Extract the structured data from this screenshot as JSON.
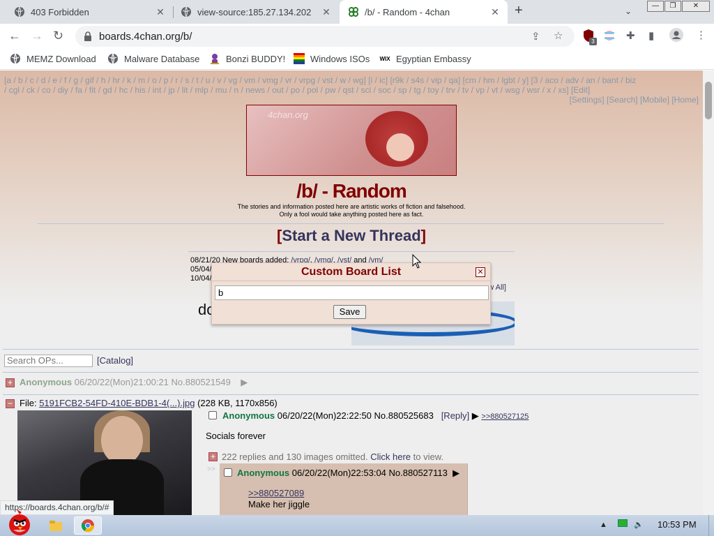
{
  "browser": {
    "tabs": [
      {
        "title": "403 Forbidden",
        "icon": "globe-icon"
      },
      {
        "title": "view-source:185.27.134.202",
        "icon": "globe-icon"
      },
      {
        "title": "/b/ - Random - 4chan",
        "icon": "clover-icon"
      }
    ],
    "url": "boards.4chan.org/b/",
    "extension_badge": "3",
    "bookmarks": [
      {
        "label": "MEMZ Download",
        "icon": "globe-icon"
      },
      {
        "label": "Malware Database",
        "icon": "globe-icon"
      },
      {
        "label": "Bonzi BUDDY!",
        "icon": "bonzi-icon"
      },
      {
        "label": "Windows ISOs",
        "icon": "windows-flag-icon"
      },
      {
        "label": "Egyptian Embassy",
        "icon": "wix-icon"
      }
    ],
    "wix_label": "WIX",
    "status_url": "https://boards.4chan.org/b/#"
  },
  "page": {
    "board_nav_line1": "[a / b / c / d / e / f / g / gif / h / hr / k / m / o / p / r / s / t / u / v / vg / vm / vmg / vr / vrpg / vst / w / wg] [i / ic] [r9k / s4s / vip / qa] [cm / hm / lgbt / y] [3 / aco / adv / an / bant / biz",
    "board_nav_line2": "/ cgl / ck / co / diy / fa / fit / gd / hc / his / int / jp / lit / mlp / mu / n / news / out / po / pol / pw / qst / sci / soc / sp / tg / toy / trv / tv / vp / vt / wsg / wsr / x / xs] [Edit]",
    "top_links": "[Settings] [Search] [Mobile] [Home]",
    "banner_logo": "4chan.org",
    "board_title": "/b/ - Random",
    "subtitle_line1": "The stories and information posted here are artistic works of fiction and falsehood.",
    "subtitle_line2": "Only a fool would take anything posted here as fact.",
    "new_thread_open": "[",
    "new_thread_label": "Start a New Thread",
    "new_thread_close": "]",
    "news_date1": "08/21/20",
    "news_text1": "New boards added:",
    "news_links": [
      "/vrpg/",
      "/vmg/",
      "/vst/",
      "/vm/"
    ],
    "news_and": "and",
    "news_date2": "05/04/",
    "news_date3": "10/04/",
    "show_all": "how All]",
    "ad_text_partial": "do",
    "search_placeholder": "Search OPs...",
    "catalog": "[Catalog]",
    "hidden_thread": {
      "name": "Anonymous",
      "datetime": "06/20/22(Mon)21:00:21",
      "no": "No.880521549",
      "arrow": "▶"
    },
    "op": {
      "file_prefix": "File:",
      "file_name": "5191FCB2-54FD-410E-BDB1-4(...).jpg",
      "file_info": "(228 KB, 1170x856)",
      "name": "Anonymous",
      "datetime": "06/20/22(Mon)22:22:50",
      "no": "No.880525683",
      "reply": "[Reply]",
      "arrow": "▶",
      "backlink": ">>880527125",
      "message": "Socials forever",
      "omitted_text": "222 replies and 130 images omitted.",
      "click_here": "Click here",
      "to_view": "to view."
    },
    "reply": {
      "arrow_marker": ">>",
      "name": "Anonymous",
      "datetime": "06/20/22(Mon)22:53:04",
      "no": "No.880527113",
      "arrow": "▶",
      "quote": ">>880527089",
      "message": "Make her jiggle"
    }
  },
  "dialog": {
    "title": "Custom Board List",
    "input_value": "b",
    "save_label": "Save",
    "close_glyph": "✕"
  },
  "taskbar": {
    "clock": "10:53 PM"
  },
  "colors": {
    "board_text": "#800000",
    "link": "#34345c",
    "name": "#117743"
  }
}
